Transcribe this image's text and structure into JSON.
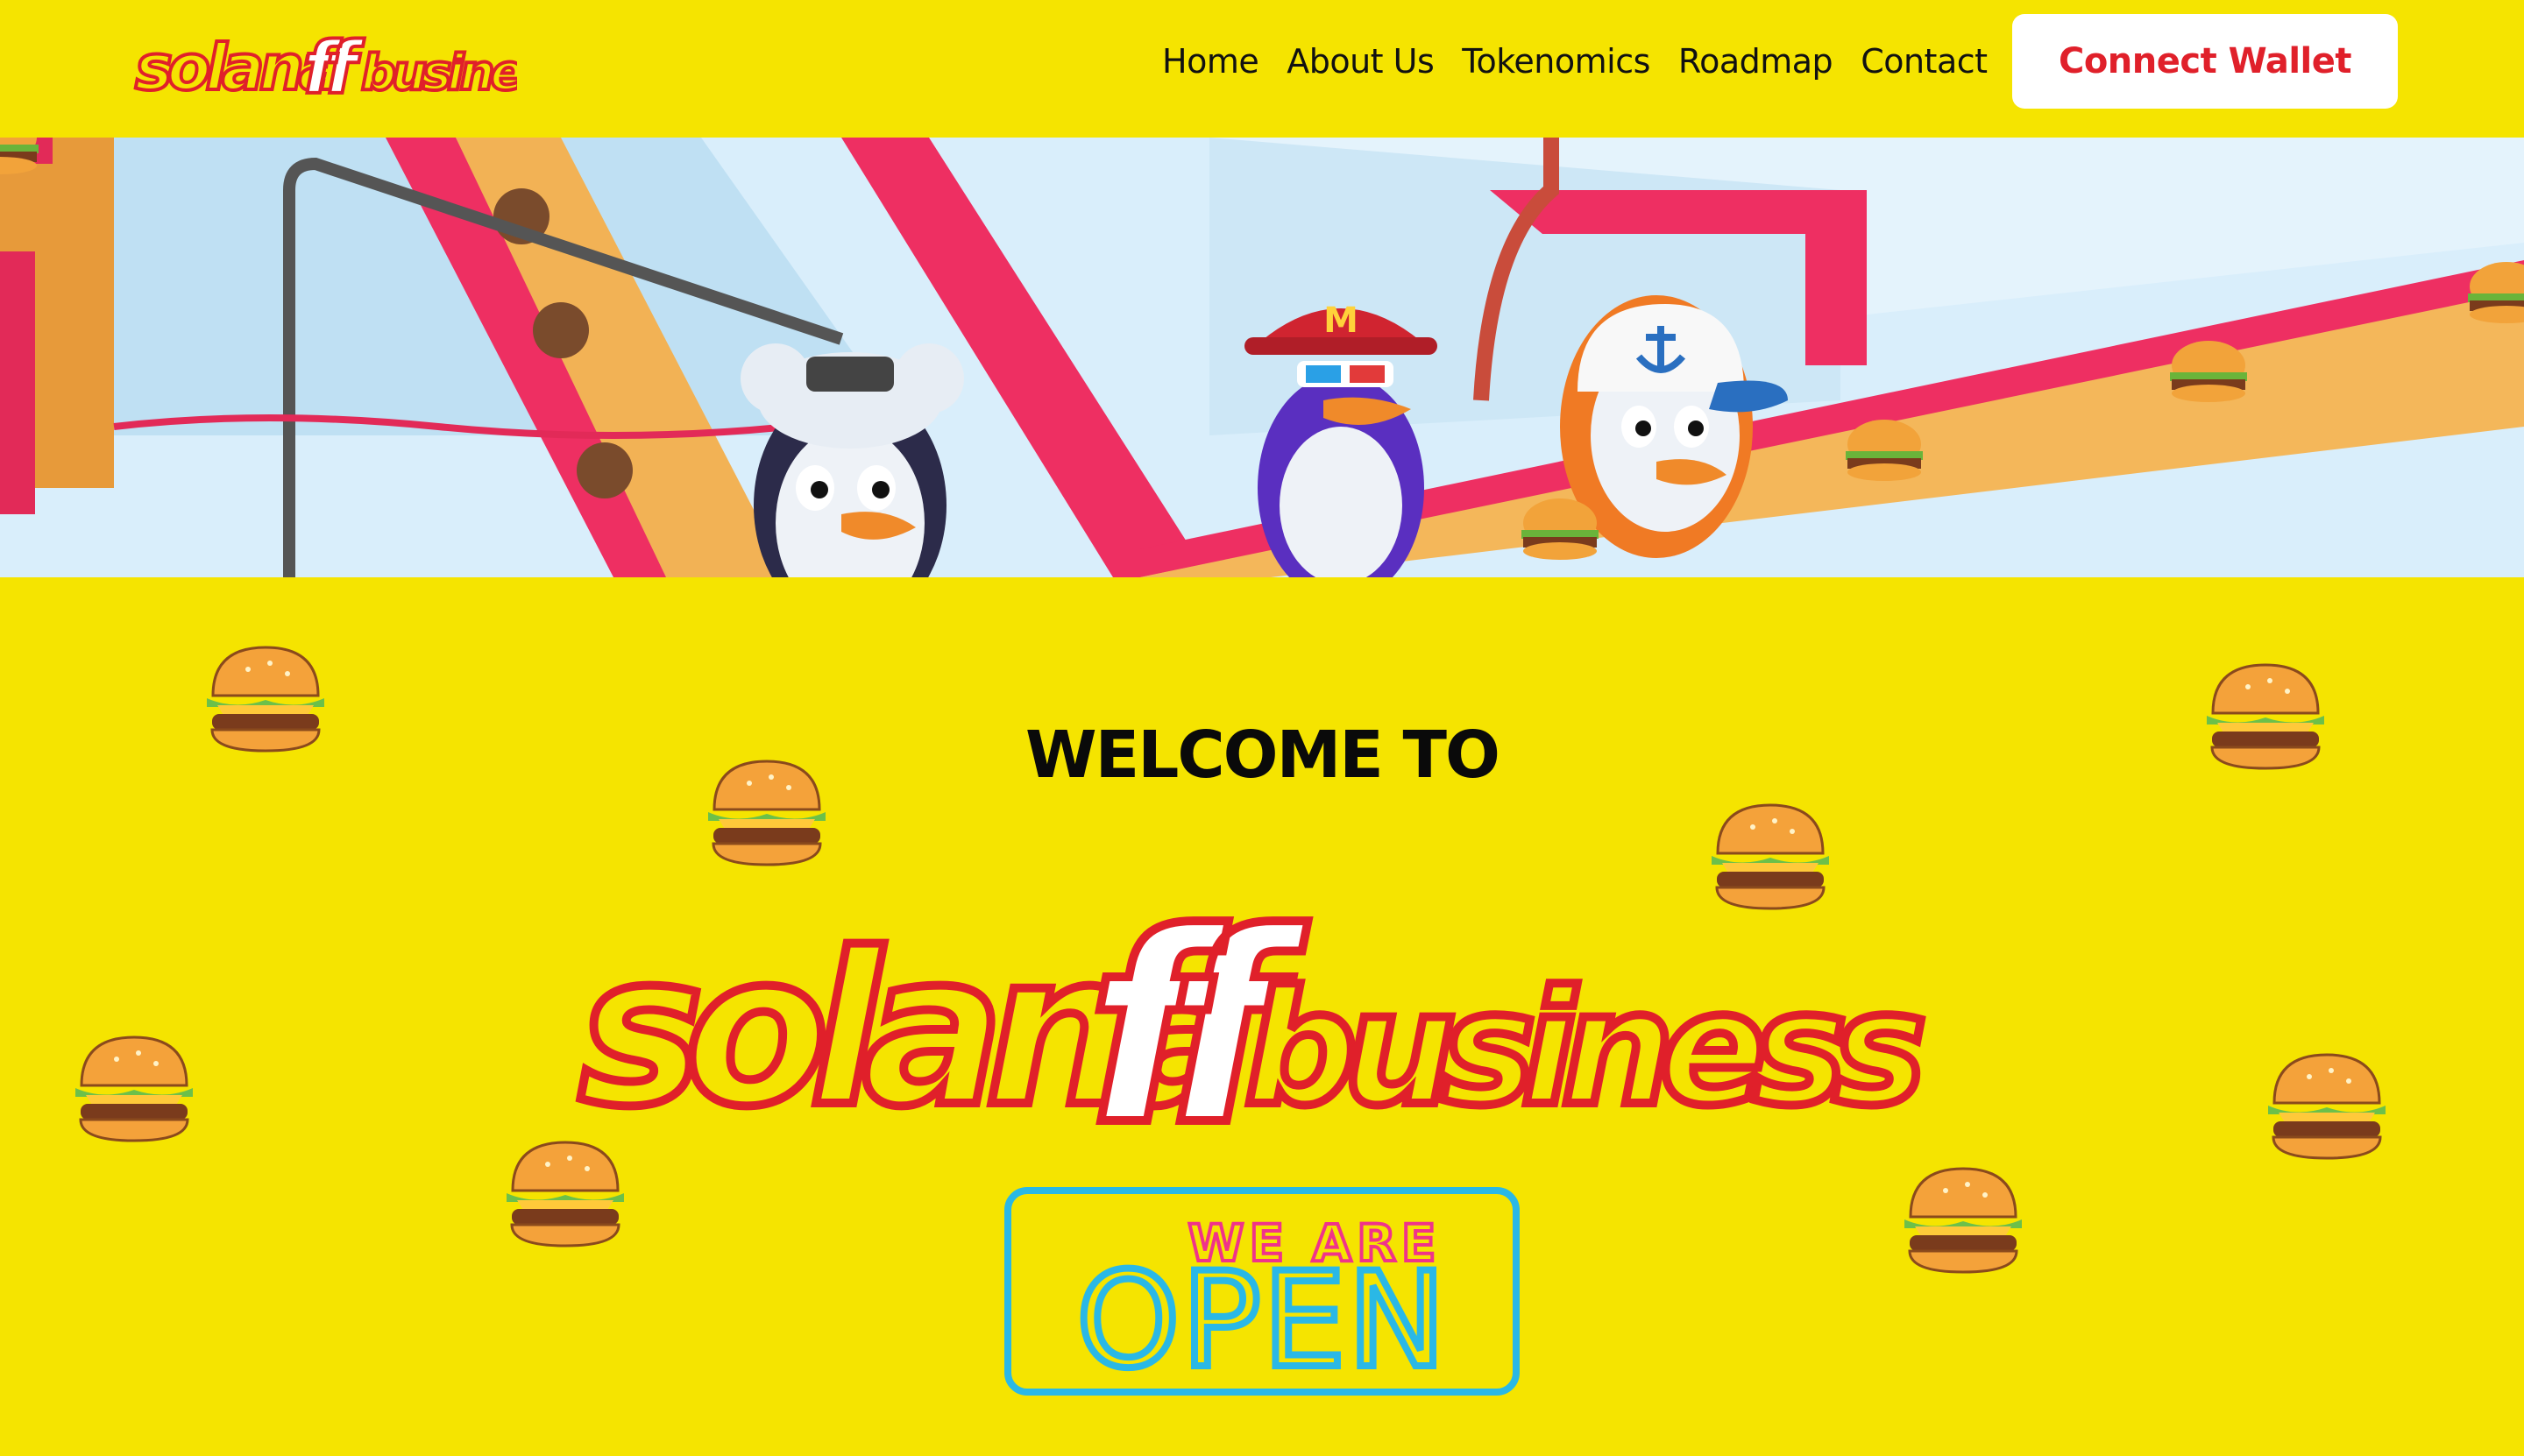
{
  "brand": {
    "name": "solanaffbusiness",
    "logo_text_left": "solana",
    "logo_text_ff": "ff",
    "logo_text_right": "business"
  },
  "nav": {
    "items": [
      {
        "label": "Home"
      },
      {
        "label": "About Us"
      },
      {
        "label": "Tokenomics"
      },
      {
        "label": "Roadmap"
      },
      {
        "label": "Contact"
      }
    ],
    "connect_label": "Connect Wallet"
  },
  "banner": {
    "cap_letter": "M"
  },
  "hero": {
    "welcome": "WELCOME TO",
    "sign_top": "WE ARE",
    "sign_bottom": "OPEN"
  },
  "colors": {
    "background": "#f5e400",
    "accent_red": "#e0202a",
    "neon_pink": "#f0338a",
    "neon_cyan": "#2ab8e6"
  },
  "icons": {
    "burger": "burger-icon",
    "anchor": "anchor-icon"
  }
}
